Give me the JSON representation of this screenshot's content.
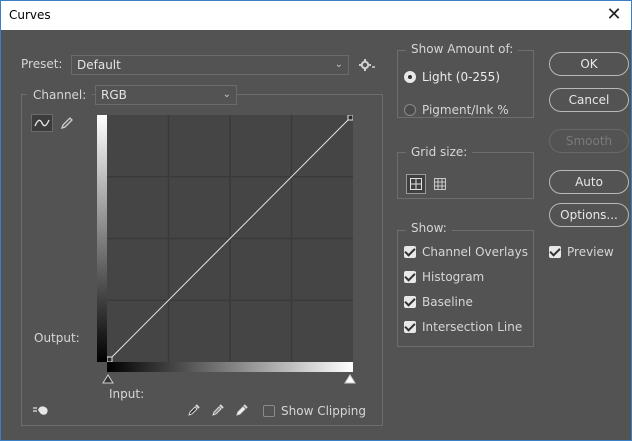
{
  "window": {
    "title": "Curves",
    "close_glyph": "✕"
  },
  "preset": {
    "label": "Preset:",
    "value": "Default",
    "gear_icon": "gear-icon"
  },
  "channel": {
    "label": "Channel:",
    "value": "RGB"
  },
  "graph": {
    "output_label": "Output:",
    "input_label": "Input:",
    "show_clipping_label": "Show Clipping",
    "show_clipping_checked": false
  },
  "show_amount": {
    "title": "Show Amount of:",
    "options": [
      {
        "label": "Light  (0-255)",
        "selected": true
      },
      {
        "label": "Pigment/Ink %",
        "selected": false
      }
    ]
  },
  "grid_size": {
    "title": "Grid size:"
  },
  "show": {
    "title": "Show:",
    "items": [
      {
        "label": "Channel Overlays",
        "checked": true
      },
      {
        "label": "Histogram",
        "checked": true
      },
      {
        "label": "Baseline",
        "checked": true
      },
      {
        "label": "Intersection Line",
        "checked": true
      }
    ]
  },
  "buttons": {
    "ok": "OK",
    "cancel": "Cancel",
    "smooth": "Smooth",
    "auto": "Auto",
    "options": "Options..."
  },
  "preview": {
    "label": "Preview",
    "checked": true
  },
  "colors": {
    "dialog_bg": "#535353",
    "graph_bg": "#454545",
    "grid_line": "#3a3a3a",
    "curve": "#e6e6e6"
  }
}
